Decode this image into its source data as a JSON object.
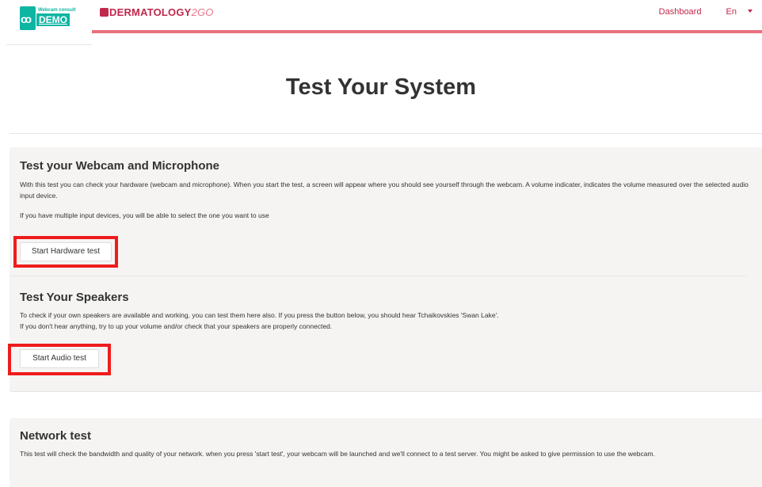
{
  "header": {
    "logo_small_text": "Webcam consult",
    "logo_label": "DEMO",
    "brand_name": "DERMATOLOGY",
    "brand_suffix": "2GO",
    "nav_dashboard": "Dashboard",
    "nav_language": "En"
  },
  "page_title": "Test Your System",
  "hardware_section": {
    "heading": "Test your Webcam and Microphone",
    "description": "With this test you can check your hardware (webcam and microphone). When you start the test, a screen will appear where you should see yourself through the webcam. A volume indicater, indicates the volume measured over the selected audio input device.",
    "note": "If you have multiple input devices, you will be able to select the one you want to use",
    "button_label": "Start Hardware test"
  },
  "speakers_section": {
    "heading": "Test Your Speakers",
    "line1": "To check if your own speakers are available and working, you can test them here also. If you press the button below, you should hear Tchaikovskies 'Swan Lake'.",
    "line2": "If you don't hear anything, try to up your volume and/or check that your speakers are properly connected.",
    "button_label": "Start Audio test"
  },
  "network_section": {
    "heading": "Network test",
    "description": "This test will check the bandwidth and quality of your network. when you press 'start test', your webcam will be launched and we'll connect to a test server. You might be asked to give permission to use the webcam."
  },
  "colors": {
    "brand": "#c0284b",
    "accent_line": "#e8707e",
    "logo_teal": "#0fb5a3",
    "highlight_red": "#ee1c1c"
  }
}
